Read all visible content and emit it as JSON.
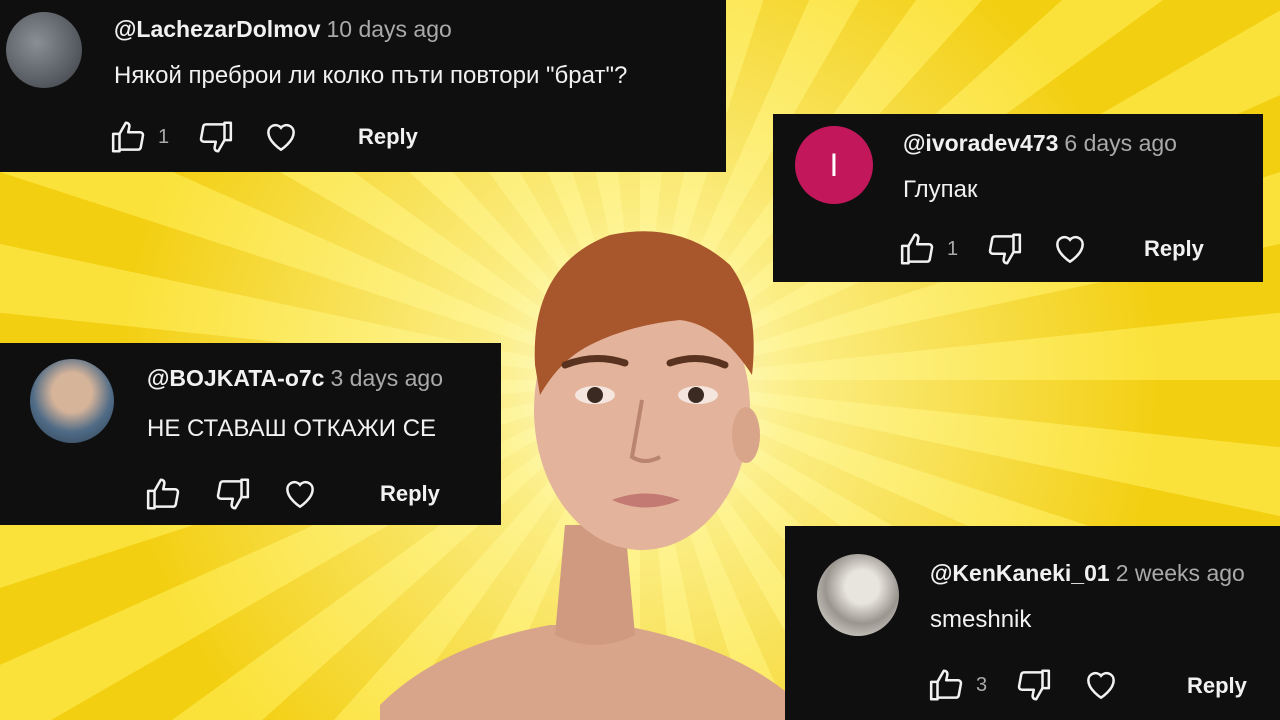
{
  "comments": [
    {
      "handle": "@LachezarDolmov",
      "time": "10 days ago",
      "text": "Някой преброи ли колко пъти повтори \"брат\"?",
      "likes": "1",
      "reply": "Reply"
    },
    {
      "handle": "@ivoradev473",
      "time": "6 days ago",
      "text": "Глупак",
      "likes": "1",
      "reply": "Reply",
      "avatar_letter": "I",
      "avatar_color": "#c2185b"
    },
    {
      "handle": "@BOJKATA-o7c",
      "time": "3 days ago",
      "text": "НЕ СТАВАШ ОТКАЖИ СЕ",
      "likes": "",
      "reply": "Reply"
    },
    {
      "handle": "@KenKaneki_01",
      "time": "2 weeks ago",
      "text": "smeshnik",
      "likes": "3",
      "reply": "Reply"
    }
  ],
  "colors": {
    "card_bg": "#0f0f0f",
    "text": "#f1f1f1",
    "muted": "#aaaaaa",
    "background": "#f7d21e"
  },
  "icons": [
    "thumbs-up-icon",
    "thumbs-down-icon",
    "heart-icon"
  ]
}
